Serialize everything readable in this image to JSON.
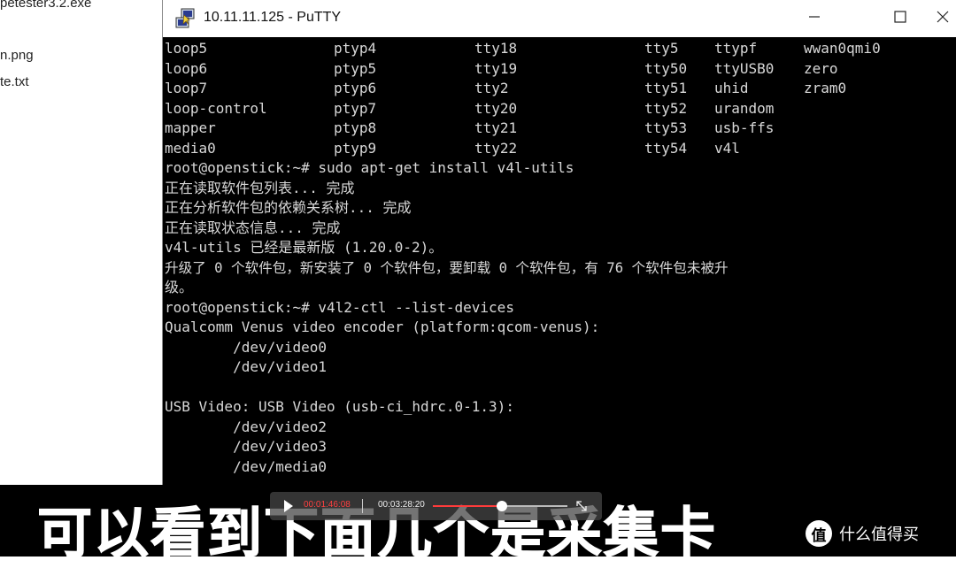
{
  "desktop": {
    "files": [
      "petester3.2.exe",
      "n.png",
      "te.txt"
    ]
  },
  "window": {
    "title": "10.11.11.125 - PuTTY",
    "app_icon": "putty-icon",
    "controls": {
      "minimize": "—",
      "maximize": "☐",
      "close": "✕"
    }
  },
  "terminal": {
    "ls_rows": [
      [
        "loop5",
        "ptyp4",
        "tty18",
        "tty5",
        "ttypf",
        "wwan0qmi0"
      ],
      [
        "loop6",
        "ptyp5",
        "tty19",
        "tty50",
        "ttyUSB0",
        "zero"
      ],
      [
        "loop7",
        "ptyp6",
        "tty2",
        "tty51",
        "uhid",
        "zram0"
      ],
      [
        "loop-control",
        "ptyp7",
        "tty20",
        "tty52",
        "urandom",
        ""
      ],
      [
        "mapper",
        "ptyp8",
        "tty21",
        "tty53",
        "usb-ffs",
        ""
      ],
      [
        "media0",
        "ptyp9",
        "tty22",
        "tty54",
        "v4l",
        ""
      ]
    ],
    "lines": [
      "root@openstick:~# sudo apt-get install v4l-utils",
      "正在读取软件包列表... 完成",
      "正在分析软件包的依赖关系树... 完成",
      "正在读取状态信息... 完成",
      "v4l-utils 已经是最新版 (1.20.0-2)。",
      "升级了 0 个软件包，新安装了 0 个软件包，要卸载 0 个软件包，有 76 个软件包未被升",
      "级。",
      "root@openstick:~# v4l2-ctl --list-devices",
      "Qualcomm Venus video encoder (platform:qcom-venus):",
      "        /dev/video0",
      "        /dev/video1",
      "",
      "USB Video: USB Video (usb-ci_hdrc.0-1.3):",
      "        /dev/video2",
      "        /dev/video3",
      "        /dev/media0"
    ]
  },
  "caption": {
    "text": "可以看到下面几个是采集卡"
  },
  "player": {
    "current_time": "00:01:46:08",
    "total_time": "00:03:28:20",
    "progress": 0.51,
    "play_icon": "play-icon",
    "fullscreen_icon": "fullscreen-icon"
  },
  "watermark": {
    "badge": "值",
    "text": "什么值得买"
  },
  "colors": {
    "terminal_bg": "#000000",
    "terminal_fg": "#d8d8d8",
    "progress_fill": "#ff3b3b",
    "current_time": "#ff4040"
  }
}
